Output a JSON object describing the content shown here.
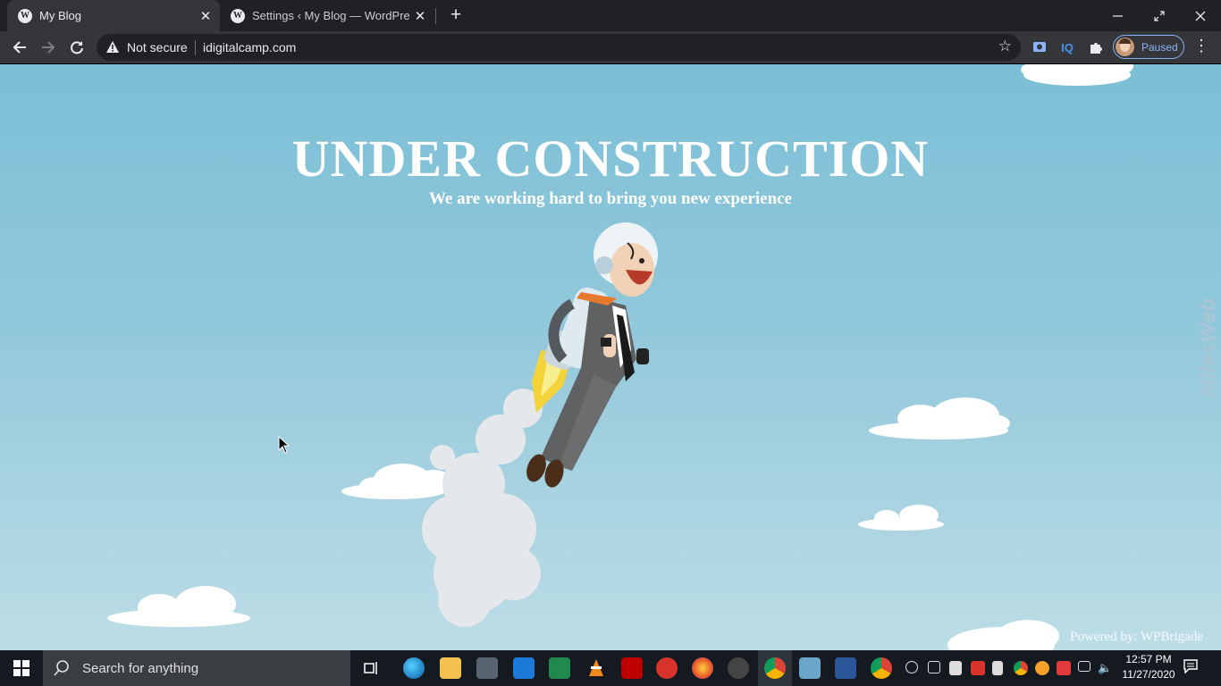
{
  "browser": {
    "tabs": [
      {
        "title": "My Blog",
        "active": true
      },
      {
        "title": "Settings ‹ My Blog — WordPress",
        "active": false
      }
    ],
    "security_label": "Not secure",
    "url": "idigitalcamp.com",
    "profile_status": "Paused",
    "extension_iq_label": "IQ"
  },
  "page": {
    "headline": "UNDER CONSTRUCTION",
    "subline": "We are working hard to bring you new experience",
    "powered_by": "Powered by: WPBrigade",
    "watermark": "MilesWeb"
  },
  "taskbar": {
    "search_placeholder": "Search for anything",
    "time": "12:57 PM",
    "date": "11/27/2020"
  },
  "colors": {
    "sky_top": "#7bbfd6",
    "sky_bottom": "#bddde6",
    "tab_bar": "#202124",
    "toolbar": "#35363a",
    "accent": "#8ab4f8",
    "taskbar": "#151a20"
  }
}
